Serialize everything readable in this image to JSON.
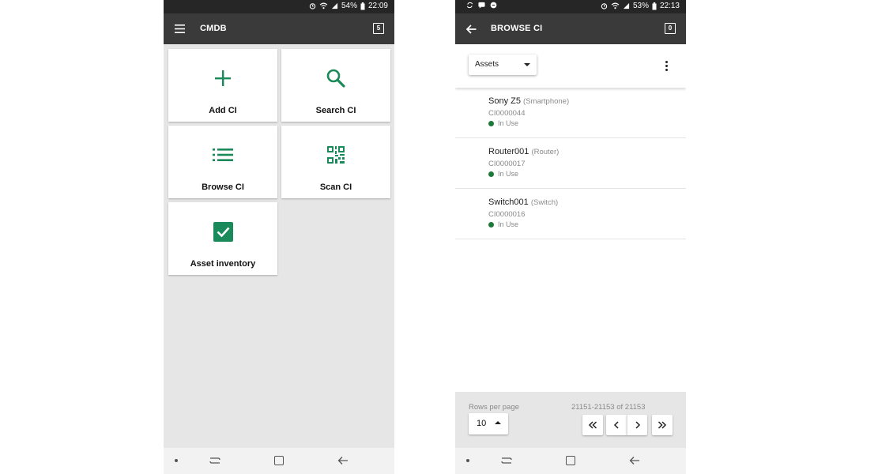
{
  "left_screen": {
    "status": {
      "battery": "54%",
      "time": "22:09"
    },
    "appbar": {
      "title": "CMDB",
      "badge": "5"
    },
    "tiles": [
      {
        "label": "Add CI",
        "icon": "plus-icon"
      },
      {
        "label": "Search CI",
        "icon": "search-icon"
      },
      {
        "label": "Browse CI",
        "icon": "list-icon"
      },
      {
        "label": "Scan CI",
        "icon": "qr-code-icon"
      },
      {
        "label": "Asset inventory",
        "icon": "checkbox-icon"
      }
    ]
  },
  "right_screen": {
    "status": {
      "battery": "53%",
      "time": "22:13"
    },
    "appbar": {
      "title": "BROWSE CI",
      "badge": "0"
    },
    "filter": {
      "selected": "Assets"
    },
    "items": [
      {
        "name": "Sony Z5",
        "type": "(Smartphone)",
        "id": "CI0000044",
        "status": "In Use"
      },
      {
        "name": "Router001",
        "type": "(Router)",
        "id": "CI0000017",
        "status": "In Use"
      },
      {
        "name": "Switch001",
        "type": "(Switch)",
        "id": "CI0000016",
        "status": "In Use"
      }
    ],
    "pager": {
      "rows_label": "Rows per page",
      "rows_value": "10",
      "range": "21151-21153 of 21153"
    }
  },
  "colors": {
    "accent": "#1b8a5a",
    "appbar": "#3a3a3a",
    "statusbar": "#262626",
    "status_dot": "#1b7a3a"
  }
}
